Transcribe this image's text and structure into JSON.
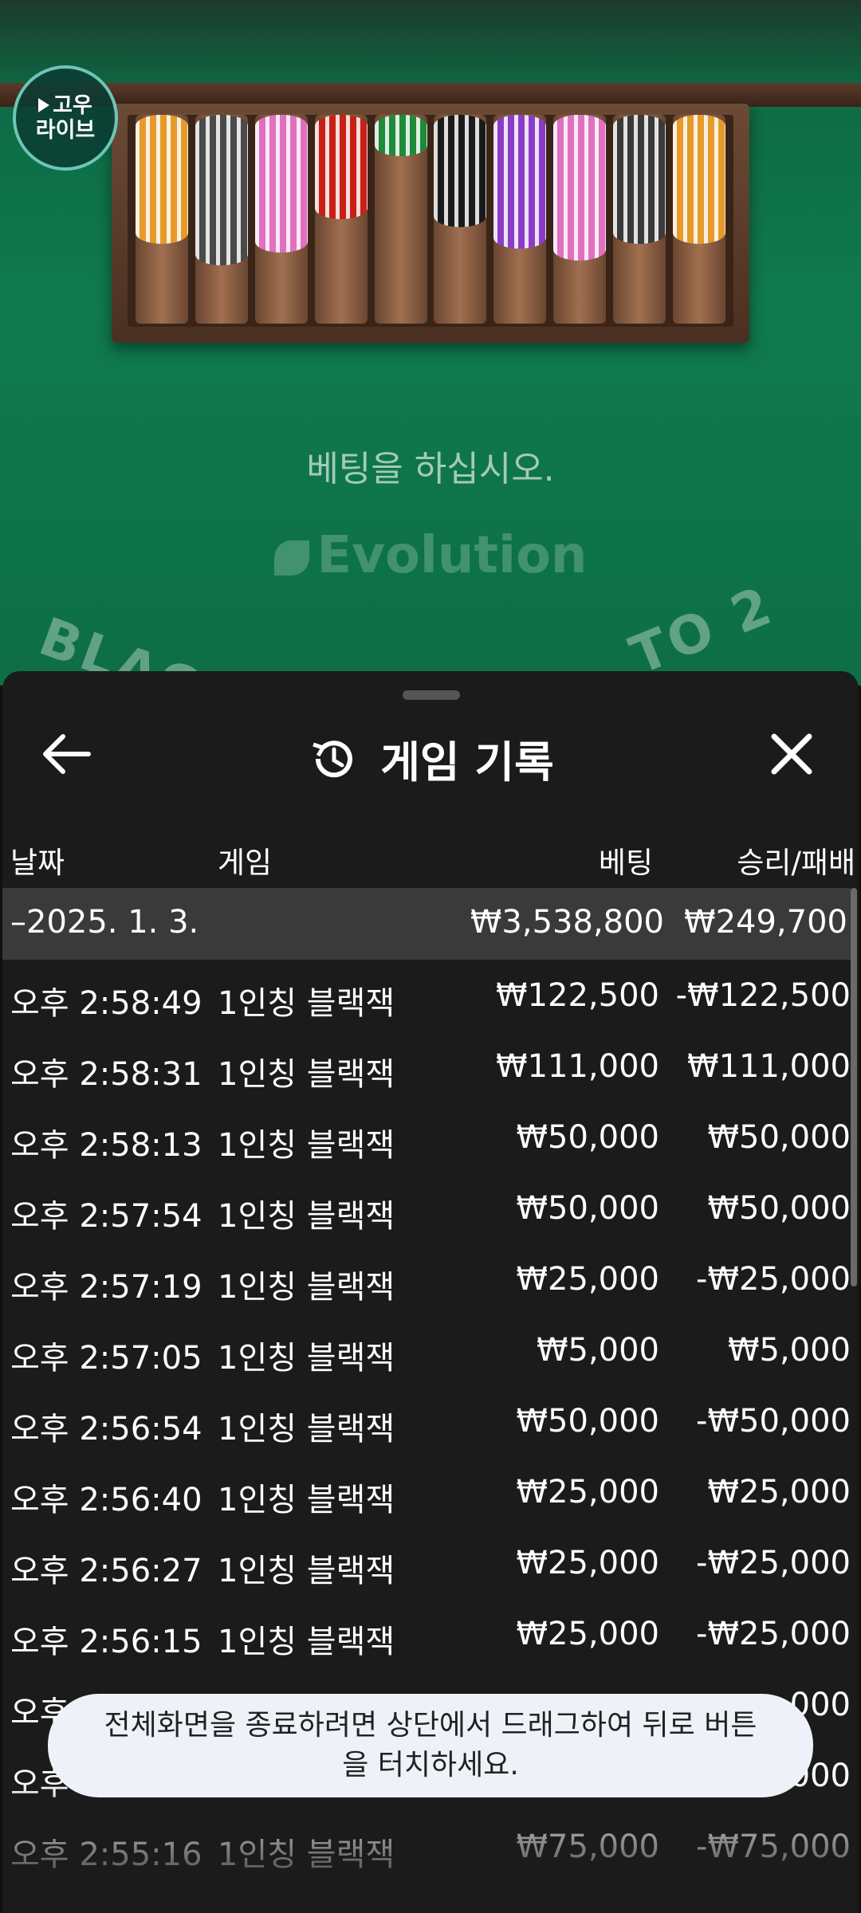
{
  "game_bg": {
    "logo_line1": "고우",
    "logo_line2": "라이브",
    "place_bets": "베팅을 하십시오.",
    "provider": "Evolution",
    "arc_left": "BLAC",
    "arc_right": "TO 2",
    "chip_colors": [
      "#e59a2a",
      "#4a4a4a",
      "#e070c0",
      "#c82016",
      "#1f8a3a",
      "#1a1a1a",
      "#8a3cc8",
      "#e070c0",
      "#3a3a3a",
      "#e59a2a"
    ],
    "chip_fill": [
      0.62,
      0.72,
      0.66,
      0.5,
      0.2,
      0.54,
      0.64,
      0.7,
      0.62,
      0.62
    ]
  },
  "sheet": {
    "title": "게임 기록",
    "columns": {
      "date": "날짜",
      "game": "게임",
      "bet": "베팅",
      "win_loss": "승리/패배"
    },
    "summary": {
      "date": "–2025. 1. 3.",
      "bet": "₩3,538,800",
      "win_loss": "₩249,700"
    },
    "rows": [
      {
        "time": "오후 2:58:49",
        "game": "1인칭 블랙잭",
        "bet": "₩122,500",
        "win_loss": "-₩122,500"
      },
      {
        "time": "오후 2:58:31",
        "game": "1인칭 블랙잭",
        "bet": "₩111,000",
        "win_loss": "₩111,000"
      },
      {
        "time": "오후 2:58:13",
        "game": "1인칭 블랙잭",
        "bet": "₩50,000",
        "win_loss": "₩50,000"
      },
      {
        "time": "오후 2:57:54",
        "game": "1인칭 블랙잭",
        "bet": "₩50,000",
        "win_loss": "₩50,000"
      },
      {
        "time": "오후 2:57:19",
        "game": "1인칭 블랙잭",
        "bet": "₩25,000",
        "win_loss": "-₩25,000"
      },
      {
        "time": "오후 2:57:05",
        "game": "1인칭 블랙잭",
        "bet": "₩5,000",
        "win_loss": "₩5,000"
      },
      {
        "time": "오후 2:56:54",
        "game": "1인칭 블랙잭",
        "bet": "₩50,000",
        "win_loss": "-₩50,000"
      },
      {
        "time": "오후 2:56:40",
        "game": "1인칭 블랙잭",
        "bet": "₩25,000",
        "win_loss": "₩25,000"
      },
      {
        "time": "오후 2:56:27",
        "game": "1인칭 블랙잭",
        "bet": "₩25,000",
        "win_loss": "-₩25,000"
      },
      {
        "time": "오후 2:56:15",
        "game": "1인칭 블랙잭",
        "bet": "₩25,000",
        "win_loss": "-₩25,000"
      },
      {
        "time": "오후",
        "game": "",
        "bet": "",
        "win_loss": "000"
      },
      {
        "time": "오후",
        "game": "",
        "bet": "",
        "win_loss": ",000"
      },
      {
        "time": "오후 2:55:16",
        "game": "1인칭 블랙잭",
        "bet": "₩75,000",
        "win_loss": "-₩75,000"
      }
    ]
  },
  "toast": {
    "message": "전체화면을 종료하려면 상단에서 드래그하여 뒤로 버튼을 터치하세요."
  }
}
